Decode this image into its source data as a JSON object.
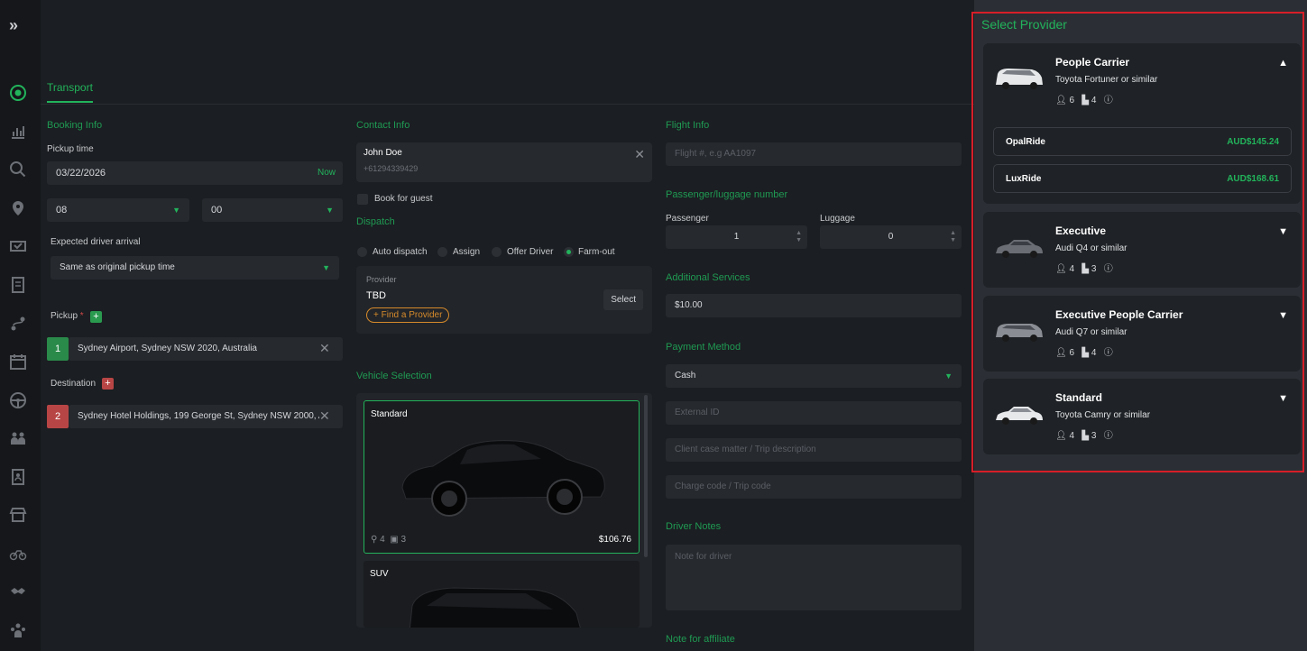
{
  "sidebar": {
    "expand_icon": "double-chevron-right-icon",
    "icons": [
      "target-icon",
      "chart-icon",
      "search-chart-icon",
      "location-pin-icon",
      "ticket-icon",
      "document-icon",
      "route-icon",
      "calendar-icon",
      "steering-wheel-icon",
      "people-icon",
      "contact-book-icon",
      "store-icon",
      "bike-icon",
      "handshake-icon",
      "team-icon"
    ]
  },
  "tabs": {
    "transport": "Transport"
  },
  "booking": {
    "title": "Booking Info",
    "pickup_time_label": "Pickup time",
    "date": "03/22/2026",
    "now": "Now",
    "hour": "08",
    "minute": "00",
    "expected_label": "Expected driver arrival",
    "expected_value": "Same as original pickup time",
    "pickup_label": "Pickup",
    "pickup_required": "*",
    "pickup_num": "1",
    "pickup_address": "Sydney Airport, Sydney NSW 2020, Australia",
    "destination_label": "Destination",
    "destination_num": "2",
    "destination_address": "Sydney Hotel Holdings, 199 George St, Sydney NSW 2000, A"
  },
  "contact": {
    "title": "Contact Info",
    "name": "John Doe",
    "phone": "+61294339429",
    "book_for_guest": "Book for guest"
  },
  "dispatch": {
    "title": "Dispatch",
    "options": [
      "Auto dispatch",
      "Assign",
      "Offer Driver",
      "Farm-out"
    ],
    "selected": "Farm-out",
    "provider_label": "Provider",
    "provider_value": "TBD",
    "find_provider": "+ Find a Provider",
    "select": "Select"
  },
  "vehicle": {
    "title": "Vehicle Selection",
    "standard_name": "Standard",
    "standard_pax": "4",
    "standard_bags": "3",
    "standard_price": "$106.76",
    "suv_name": "SUV"
  },
  "flight": {
    "title": "Flight Info",
    "placeholder": "Flight #, e.g AA1097"
  },
  "pax": {
    "title": "Passenger/luggage number",
    "passenger_label": "Passenger",
    "passenger_value": "1",
    "luggage_label": "Luggage",
    "luggage_value": "0"
  },
  "services": {
    "title": "Additional Services",
    "value": "$10.00"
  },
  "payment": {
    "title": "Payment Method",
    "value": "Cash",
    "external_id": "External ID",
    "client_case": "Client case matter / Trip description",
    "charge_code": "Charge code / Trip code"
  },
  "driver_notes": {
    "title": "Driver Notes",
    "placeholder": "Note for driver"
  },
  "affiliate": {
    "title": "Note for affiliate"
  },
  "provider_panel": {
    "title": "Select Provider",
    "cards": [
      {
        "name": "People Carrier",
        "sub": "Toyota Fortuner or similar",
        "pax": "6",
        "bags": "4",
        "expanded": true,
        "options": [
          {
            "name": "OpalRide",
            "price": "AUD$145.24"
          },
          {
            "name": "LuxRide",
            "price": "AUD$168.61"
          }
        ]
      },
      {
        "name": "Executive",
        "sub": "Audi Q4 or similar",
        "pax": "4",
        "bags": "3"
      },
      {
        "name": "Executive People Carrier",
        "sub": "Audi Q7 or similar",
        "pax": "6",
        "bags": "4"
      },
      {
        "name": "Standard",
        "sub": "Toyota Camry or similar",
        "pax": "4",
        "bags": "3"
      }
    ]
  },
  "colors": {
    "accent": "#22b35b",
    "highlight_border": "#d71e28",
    "warning": "#d68a2b"
  }
}
